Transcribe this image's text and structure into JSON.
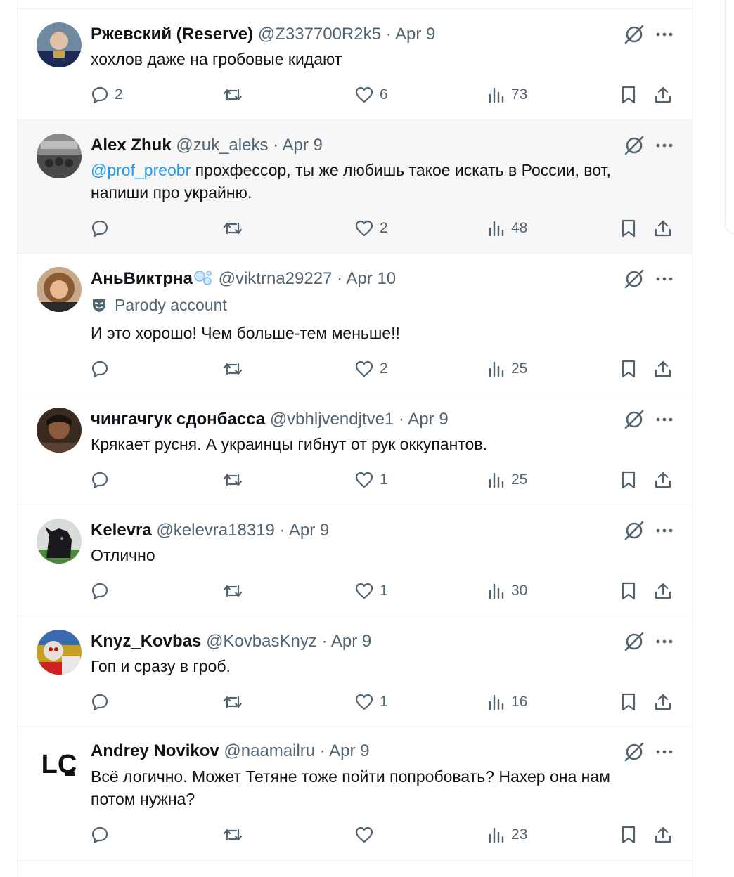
{
  "tweets": [
    {
      "name": "Ржевский (Reserve)",
      "handle": "@Z337700R2k5",
      "date": "Apr 9",
      "text": "хохлов даже на гробовые кидают",
      "replies": "2",
      "reposts": "",
      "likes": "6",
      "views": "73"
    },
    {
      "name": "Alex Zhuk",
      "handle": "@zuk_aleks",
      "date": "Apr 9",
      "mention": "@prof_preobr",
      "text": " прохфессор, ты же любишь такое искать в России, вот, напиши про украйню.",
      "replies": "",
      "reposts": "",
      "likes": "2",
      "views": "48"
    },
    {
      "name": "АньВиктрна",
      "handle": "@viktrna29227",
      "date": "Apr 10",
      "badge": "Parody account",
      "text": "И это хорошо! Чем больше-тем меньше!!",
      "replies": "",
      "reposts": "",
      "likes": "2",
      "views": "25"
    },
    {
      "name": "чингачгук сдонбасса",
      "handle": "@vbhljvendjtve1",
      "date": "Apr 9",
      "text": "Крякает русня. А украинцы гибнут от рук оккупантов.",
      "replies": "",
      "reposts": "",
      "likes": "1",
      "views": "25"
    },
    {
      "name": "Kelevra",
      "handle": "@kelevra18319",
      "date": "Apr 9",
      "text": "Отлично",
      "replies": "",
      "reposts": "",
      "likes": "1",
      "views": "30"
    },
    {
      "name": "Knyz_Kovbas",
      "handle": "@KovbasKnyz",
      "date": "Apr 9",
      "text": "Гоп и сразу в гроб.",
      "replies": "",
      "reposts": "",
      "likes": "1",
      "views": "16"
    },
    {
      "name": "Andrey Novikov",
      "handle": "@naamailru",
      "date": "Apr 9",
      "text": "Всё логично. Может Тетяне тоже пойти попробовать? Нахер она нам потом нужна?",
      "replies": "",
      "reposts": "",
      "likes": "",
      "views": "23"
    }
  ],
  "separator": " · ",
  "logo_text": "LC",
  "colors": {
    "text": "#0f1419",
    "muted": "#536471",
    "link": "#1d9bf0",
    "divider": "#eff3f4",
    "hover": "#f7f7f7"
  }
}
